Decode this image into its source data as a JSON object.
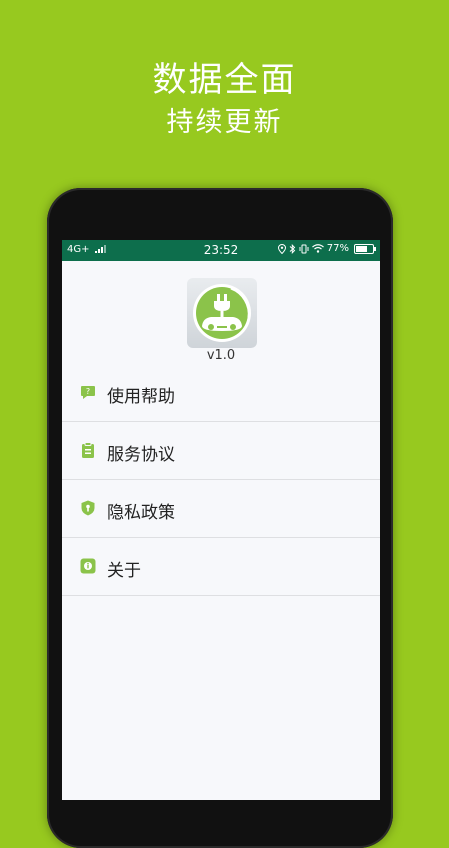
{
  "promo": {
    "headline": "数据全面",
    "subline": "持续更新"
  },
  "status_bar": {
    "network": "4G+",
    "time": "23:52",
    "battery_text": "77%",
    "battery_level": 0.77
  },
  "app": {
    "version": "v1.0"
  },
  "menu": {
    "items": [
      {
        "label": "使用帮助",
        "icon": "help-icon"
      },
      {
        "label": "服务协议",
        "icon": "clipboard-icon"
      },
      {
        "label": "隐私政策",
        "icon": "shield-icon"
      },
      {
        "label": "关于",
        "icon": "info-icon"
      }
    ]
  },
  "colors": {
    "background": "#97c91f",
    "status_bar": "#0d6e4c",
    "accent": "#8bc34a"
  }
}
